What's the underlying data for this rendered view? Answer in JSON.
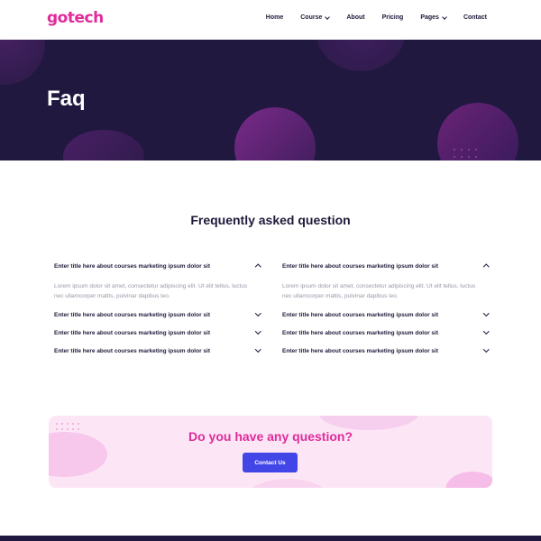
{
  "header": {
    "logo": "gotech",
    "nav": [
      {
        "label": "Home",
        "dropdown": false
      },
      {
        "label": "Course",
        "dropdown": true
      },
      {
        "label": "About",
        "dropdown": false
      },
      {
        "label": "Pricing",
        "dropdown": false
      },
      {
        "label": "Pages",
        "dropdown": true
      },
      {
        "label": "Contact",
        "dropdown": false
      }
    ]
  },
  "hero": {
    "title": "Faq"
  },
  "faq": {
    "title": "Frequently asked question",
    "left": [
      {
        "question": "Enter title here about courses marketing ipsum dolor sit",
        "answer": "Lorem ipsum dolor sit amet, consectetur adipiscing elit. Ut elit tellus, luctus nec ullamcorper mattis, pulvinar dapibus leo.",
        "expanded": true
      },
      {
        "question": "Enter title here about courses marketing ipsum dolor sit",
        "answer": "",
        "expanded": false
      },
      {
        "question": "Enter title here about courses marketing ipsum dolor sit",
        "answer": "",
        "expanded": false
      },
      {
        "question": "Enter title here about courses marketing ipsum dolor sit",
        "answer": "",
        "expanded": false
      }
    ],
    "right": [
      {
        "question": "Enter title here about courses marketing ipsum dolor sit",
        "answer": "Lorem ipsum dolor sit amet, consectetur adipiscing elit. Ut elit tellus, luctus nec ullamcorper mattis, pulvinar dapibus leo.",
        "expanded": true
      },
      {
        "question": "Enter title here about courses marketing ipsum dolor sit",
        "answer": "",
        "expanded": false
      },
      {
        "question": "Enter title here about courses marketing ipsum dolor sit",
        "answer": "",
        "expanded": false
      },
      {
        "question": "Enter title here about courses marketing ipsum dolor sit",
        "answer": "",
        "expanded": false
      }
    ]
  },
  "cta": {
    "title": "Do you have any question?",
    "button": "Contact Us"
  },
  "colors": {
    "brand": "#e02b9a",
    "dark": "#20183f",
    "button": "#4346e6",
    "cta_bg": "#fce6f6"
  }
}
